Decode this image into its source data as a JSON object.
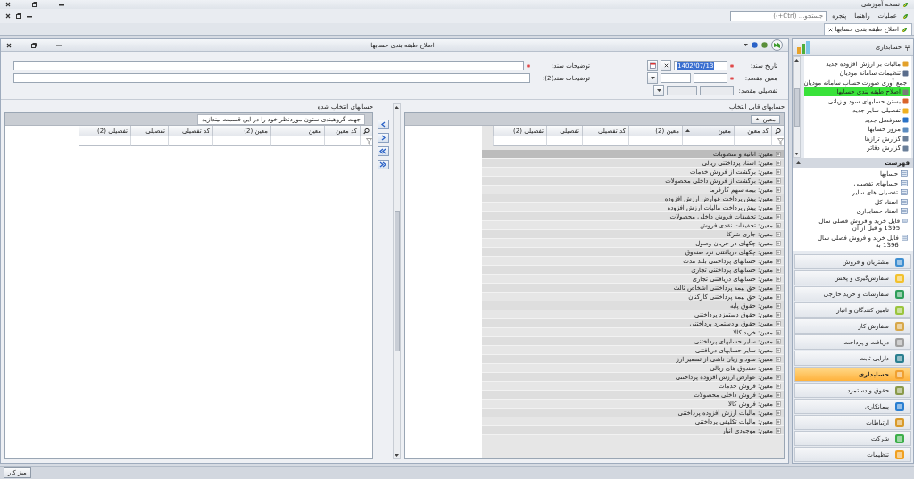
{
  "app": {
    "title": "نسخه آموزشی",
    "menu": [
      "عملیات",
      "راهنما",
      "پنجره"
    ],
    "search_placeholder": "جستجو... (Ctrl+-)"
  },
  "doc_tabs": [
    {
      "label": "اصلاح طبقه بندی حسابها",
      "selected": true
    }
  ],
  "form": {
    "title": "اصلاح طبقه بندی حسابها",
    "date": {
      "label": "تاریخ سند:",
      "required": true,
      "value": "1402/07/13"
    },
    "description": {
      "label": "توضیحات سند:",
      "required": true
    },
    "target_moein": {
      "label": "معین مقصد:",
      "required": true,
      "disabled": false
    },
    "description2": {
      "label": "توضیحات سند(2):",
      "required": false
    },
    "target_tafsili": {
      "label": "تفصیلی مقصد:",
      "required": false,
      "disabled": true
    }
  },
  "available": {
    "title": "حسابهای قابل انتخاب",
    "group_chip": "معین",
    "columns": [
      {
        "label": "کد معین",
        "sorted": false
      },
      {
        "label": "معین",
        "sorted": true
      },
      {
        "label": "معین (2)",
        "sorted": false
      },
      {
        "label": "کد تفصیلی",
        "sorted": false
      },
      {
        "label": "تفصیلی",
        "sorted": false
      },
      {
        "label": "تفصیلی (2)",
        "sorted": false
      }
    ],
    "rows": [
      {
        "text": "معین: اثاثیه و منصوبات",
        "selected": true
      },
      {
        "text": "معین: اسناد پرداختنی ریالی",
        "selected": false
      },
      {
        "text": "معین: برگشت از فروش خدمات",
        "selected": false
      },
      {
        "text": "معین: برگشت از فروش داخلی محصولات",
        "selected": false
      },
      {
        "text": "معین: بیمه سهم کارفرما",
        "selected": false
      },
      {
        "text": "معین: پیش پرداخت عوارض ارزش افزوده",
        "selected": false
      },
      {
        "text": "معین: پیش پرداخت مالیات ارزش افزوده",
        "selected": false
      },
      {
        "text": "معین: تخفیفات فروش داخلی محصولات",
        "selected": false
      },
      {
        "text": "معین: تخفیفات نقدی فروش",
        "selected": false
      },
      {
        "text": "معین: جاری شرکا",
        "selected": false
      },
      {
        "text": "معین: چکهای در جریان وصول",
        "selected": false
      },
      {
        "text": "معین: چکهای دریافتنی نزد صندوق",
        "selected": false
      },
      {
        "text": "معین: حسابهای پرداختنی بلند مدت",
        "selected": false
      },
      {
        "text": "معین: حسابهای پرداختنی تجاری",
        "selected": false
      },
      {
        "text": "معین: حسابهای دریافتنی تجاری",
        "selected": false
      },
      {
        "text": "معین: حق بیمه پرداختنی اشخاص ثالث",
        "selected": false
      },
      {
        "text": "معین: حق بیمه پرداختنی کارکنان",
        "selected": false
      },
      {
        "text": "معین: حقوق پایه",
        "selected": false
      },
      {
        "text": "معین: حقوق دستمزد پرداختنی",
        "selected": false
      },
      {
        "text": "معین: حقوق و دستمزد پرداختنی",
        "selected": false
      },
      {
        "text": "معین: خرید کالا",
        "selected": false
      },
      {
        "text": "معین: سایر حسابهای پرداختنی",
        "selected": false
      },
      {
        "text": "معین: سایر حسابهای دریافتنی",
        "selected": false
      },
      {
        "text": "معین: سود و زیان ناشی از تسعیر ارز",
        "selected": false
      },
      {
        "text": "معین: صندوق های ریالی",
        "selected": false
      },
      {
        "text": "معین: عوارض ارزش افزوده پرداختنی",
        "selected": false
      },
      {
        "text": "معین: فروش خدمات",
        "selected": false
      },
      {
        "text": "معین: فروش داخلی محصولات",
        "selected": false
      },
      {
        "text": "معین: فروش کالا",
        "selected": false
      },
      {
        "text": "معین: مالیات ارزش افزوده پرداختنی",
        "selected": false
      },
      {
        "text": "معین: مالیات تکلیفی پرداختنی",
        "selected": false
      },
      {
        "text": "معین: موجودی انبار",
        "selected": false
      }
    ]
  },
  "chosen": {
    "title": "حسابهای انتخاب شده",
    "group_hint": "جهت گروهبندی ستون موردنظر خود را در این قسمت بیندازید",
    "columns": [
      {
        "label": "کد معین",
        "sorted": false
      },
      {
        "label": "معین",
        "sorted": false
      },
      {
        "label": "معین (2)",
        "sorted": false
      },
      {
        "label": "کد تفصیلی",
        "sorted": false
      },
      {
        "label": "تفصیلی",
        "sorted": false
      },
      {
        "label": "تفصیلی (2)",
        "sorted": false
      }
    ]
  },
  "sidebar": {
    "title": "حسابداری",
    "tasks": [
      {
        "label": "مالیات بر ارزش افزوده جدید",
        "selected": false
      },
      {
        "label": "تنظیمات سامانه مودیان",
        "selected": false
      },
      {
        "label": "جمع آوری صورت حساب سامانه مودیان",
        "selected": false
      },
      {
        "label": "اصلاح طبقه بندی حسابها",
        "selected": true
      },
      {
        "label": "بستن حسابهای سود و زیانی",
        "selected": false
      },
      {
        "label": "تفصیلی سایر جدید",
        "selected": false
      },
      {
        "label": "سرفصل جدید",
        "selected": false
      },
      {
        "label": "مرور حسابها",
        "selected": false
      },
      {
        "label": "گزارش ترازها",
        "selected": false
      },
      {
        "label": "گزارش دفاتر",
        "selected": false
      }
    ],
    "list_title": "فهرست",
    "lists": [
      "حسابها",
      "حسابهای تفصیلی",
      "تفصیلی های سایر",
      "اسناد کل",
      "اسناد حسابداری",
      "فایل خرید و فروش فصلی سال 1395 و قبل از آن",
      "فایل خرید و فروش فصلی سال 1396 به"
    ],
    "modules": [
      {
        "label": "مشتریان و فروش",
        "selected": false
      },
      {
        "label": "سفارش‌گیری و پخش",
        "selected": false
      },
      {
        "label": "سفارشات و خرید خارجی",
        "selected": false
      },
      {
        "label": "تامین کنندگان و انبار",
        "selected": false
      },
      {
        "label": "سفارش کار",
        "selected": false
      },
      {
        "label": "دریافت و پرداخت",
        "selected": false
      },
      {
        "label": "دارایی ثابت",
        "selected": false
      },
      {
        "label": "حسابداری",
        "selected": true
      },
      {
        "label": "حقوق و دستمزد",
        "selected": false
      },
      {
        "label": "پیمانکاری",
        "selected": false
      },
      {
        "label": "ارتباطات",
        "selected": false
      },
      {
        "label": "شرکت",
        "selected": false
      },
      {
        "label": "تنظیمات",
        "selected": false
      }
    ]
  },
  "status_bar": {
    "button": "میز کار"
  }
}
